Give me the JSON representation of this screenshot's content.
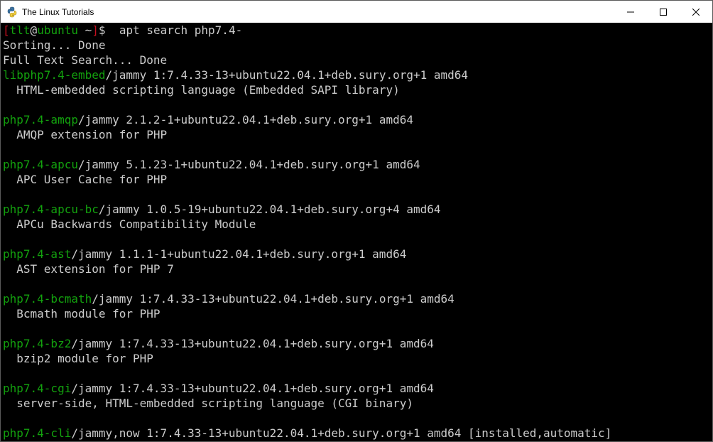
{
  "window": {
    "title": "The Linux Tutorials",
    "controls": {
      "minimize_icon": "minimize-icon",
      "maximize_icon": "maximize-icon",
      "close_icon": "close-icon"
    }
  },
  "colors": {
    "background": "#000000",
    "text": "#cccccc",
    "package_name": "#13a10e",
    "prompt_bracket": "#c50f1f",
    "prompt_host": "#13a10e",
    "prompt_user": "#13a10e"
  },
  "prompt": {
    "open_bracket": "[",
    "user": "tlt",
    "at": "@",
    "host": "ubuntu",
    "space": " ",
    "cwd": "~",
    "close_bracket": "]",
    "symbol": "$",
    "command": "  apt search php7.4-"
  },
  "output": {
    "status_lines": [
      "Sorting... Done",
      "Full Text Search... Done"
    ],
    "packages": [
      {
        "name": "libphp7.4-embed",
        "info": "/jammy 1:7.4.33-13+ubuntu22.04.1+deb.sury.org+1 amd64",
        "description": "  HTML-embedded scripting language (Embedded SAPI library)"
      },
      {
        "name": "php7.4-amqp",
        "info": "/jammy 2.1.2-1+ubuntu22.04.1+deb.sury.org+1 amd64",
        "description": "  AMQP extension for PHP"
      },
      {
        "name": "php7.4-apcu",
        "info": "/jammy 5.1.23-1+ubuntu22.04.1+deb.sury.org+1 amd64",
        "description": "  APC User Cache for PHP"
      },
      {
        "name": "php7.4-apcu-bc",
        "info": "/jammy 1.0.5-19+ubuntu22.04.1+deb.sury.org+4 amd64",
        "description": "  APCu Backwards Compatibility Module"
      },
      {
        "name": "php7.4-ast",
        "info": "/jammy 1.1.1-1+ubuntu22.04.1+deb.sury.org+1 amd64",
        "description": "  AST extension for PHP 7"
      },
      {
        "name": "php7.4-bcmath",
        "info": "/jammy 1:7.4.33-13+ubuntu22.04.1+deb.sury.org+1 amd64",
        "description": "  Bcmath module for PHP"
      },
      {
        "name": "php7.4-bz2",
        "info": "/jammy 1:7.4.33-13+ubuntu22.04.1+deb.sury.org+1 amd64",
        "description": "  bzip2 module for PHP"
      },
      {
        "name": "php7.4-cgi",
        "info": "/jammy 1:7.4.33-13+ubuntu22.04.1+deb.sury.org+1 amd64",
        "description": "  server-side, HTML-embedded scripting language (CGI binary)"
      },
      {
        "name": "php7.4-cli",
        "info": "/jammy,now 1:7.4.33-13+ubuntu22.04.1+deb.sury.org+1 amd64 [installed,automatic]",
        "description": ""
      }
    ]
  }
}
